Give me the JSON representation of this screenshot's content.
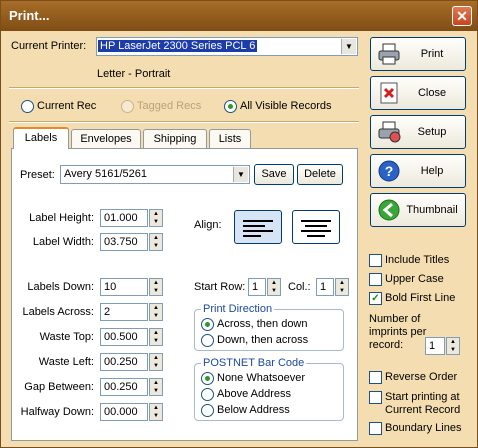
{
  "window": {
    "title": "Print..."
  },
  "printer": {
    "label": "Current Printer:",
    "value": "HP LaserJet 2300 Series PCL 6",
    "paper": "Letter - Portrait"
  },
  "records": {
    "options": [
      {
        "label": "Current Rec",
        "state": "off"
      },
      {
        "label": "Tagged Recs",
        "state": "disabled"
      },
      {
        "label": "All Visible Records",
        "state": "on"
      }
    ]
  },
  "tabs": [
    "Labels",
    "Envelopes",
    "Shipping",
    "Lists"
  ],
  "labels": {
    "preset_label": "Preset:",
    "preset_value": "Avery 5161/5261",
    "save": "Save",
    "delete": "Delete",
    "height_label": "Label Height:",
    "height": "01.000",
    "width_label": "Label Width:",
    "width": "03.750",
    "align_label": "Align:",
    "down_label": "Labels Down:",
    "down": "10",
    "across_label": "Labels Across:",
    "across": "2",
    "waste_top_label": "Waste Top:",
    "waste_top": "00.500",
    "waste_left_label": "Waste Left:",
    "waste_left": "00.250",
    "gap_label": "Gap Between:",
    "gap": "00.250",
    "halfway_label": "Halfway Down:",
    "halfway": "00.000",
    "start_row_label": "Start Row:",
    "start_row": "1",
    "col_label": "Col.:",
    "col": "1",
    "direction_title": "Print Direction",
    "direction_options": [
      "Across, then down",
      "Down, then across"
    ],
    "postnet_title": "POSTNET Bar Code",
    "postnet_options": [
      "None Whatsoever",
      "Above Address",
      "Below Address"
    ]
  },
  "buttons": {
    "print": "Print",
    "close": "Close",
    "setup": "Setup",
    "help": "Help",
    "thumbnail": "Thumbnail"
  },
  "options": {
    "include_titles": "Include Titles",
    "upper_case": "Upper Case",
    "bold_first_line": "Bold First Line",
    "imprints_label": "Number of imprints per record:",
    "imprints": "1",
    "reverse_order": "Reverse Order",
    "start_current": "Start printing at Current Record",
    "boundary_lines": "Boundary Lines"
  },
  "state": {
    "include_titles": false,
    "upper_case": false,
    "bold_first_line": true,
    "reverse_order": false,
    "start_current": false,
    "boundary_lines": false
  },
  "colors": {
    "dialog_bg": "#f4ddb0",
    "title_bar": "#8f5a1c",
    "accent": "#1c3caa"
  }
}
